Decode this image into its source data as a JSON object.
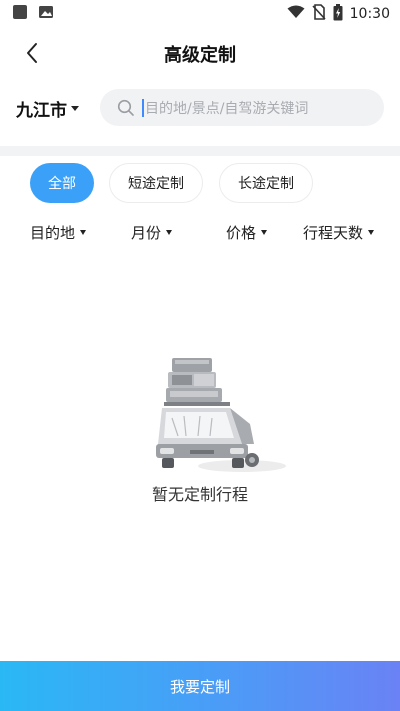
{
  "status_bar": {
    "time": "10:30",
    "icons": [
      "notification-square-icon",
      "gallery-icon",
      "wifi-icon",
      "no-sim-icon",
      "battery-charging-icon"
    ]
  },
  "header": {
    "title": "高级定制",
    "back_icon": "chevron-left-icon"
  },
  "search": {
    "city": "九江市",
    "placeholder": "目的地/景点/自驾游关键词",
    "icon": "search-icon"
  },
  "tabs": [
    {
      "label": "全部",
      "active": true
    },
    {
      "label": "短途定制",
      "active": false
    },
    {
      "label": "长途定制",
      "active": false
    }
  ],
  "filters": [
    {
      "label": "目的地"
    },
    {
      "label": "月份"
    },
    {
      "label": "价格"
    },
    {
      "label": "行程天数"
    }
  ],
  "empty_state": {
    "message": "暂无定制行程",
    "illustration": "car-with-luggage-illustration"
  },
  "bottom_button": {
    "label": "我要定制"
  },
  "colors": {
    "accent": "#3aa0f8",
    "button_gradient_start": "#2ab8f5",
    "button_gradient_end": "#6a82f5",
    "search_bg": "#f1f2f4",
    "divider": "#f2f3f5"
  }
}
